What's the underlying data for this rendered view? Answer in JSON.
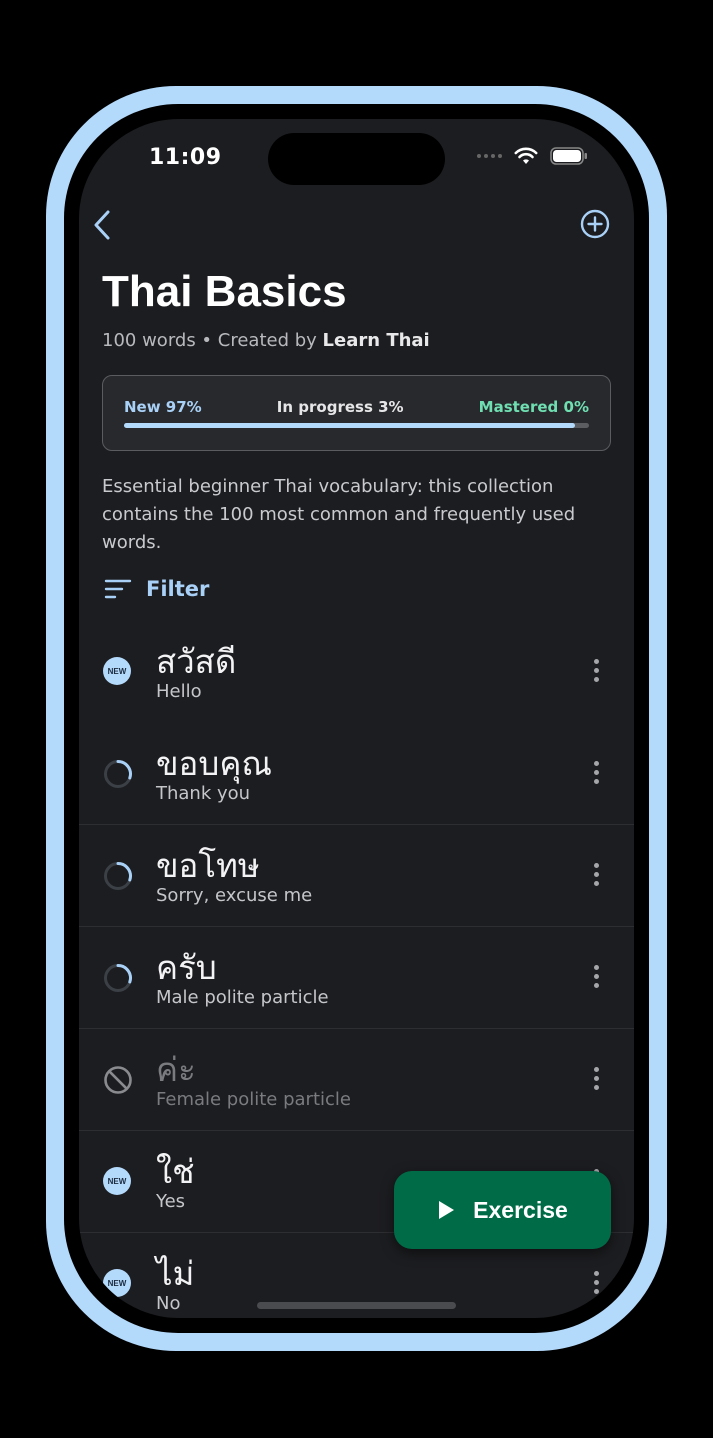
{
  "status_bar": {
    "time": "11:09"
  },
  "header": {
    "title": "Thai Basics",
    "word_count": "100 words",
    "separator": " • ",
    "created_by_prefix": "Created by ",
    "author": "Learn Thai"
  },
  "progress": {
    "new_label": "New 97%",
    "in_progress_label": "In progress 3%",
    "mastered_label": "Mastered 0%",
    "new_fraction": 0.97,
    "colors": {
      "new": "#a9d1f7",
      "mastered": "#6fdfb2",
      "track": "#5b5d61"
    }
  },
  "description": "Essential beginner Thai vocabulary: this collection contains the 100 most common and frequently used words.",
  "filter": {
    "label": "Filter"
  },
  "words": [
    {
      "thai": "สวัสดี",
      "english": "Hello",
      "status": "new"
    },
    {
      "thai": "ขอบคุณ",
      "english": "Thank you",
      "status": "in-progress"
    },
    {
      "thai": "ขอโทษ",
      "english": "Sorry, excuse me",
      "status": "in-progress"
    },
    {
      "thai": "ครับ",
      "english": "Male polite particle",
      "status": "in-progress"
    },
    {
      "thai": "ค่ะ",
      "english": "Female polite particle",
      "status": "excluded"
    },
    {
      "thai": "ใช่",
      "english": "Yes",
      "status": "new"
    },
    {
      "thai": "ไม่",
      "english": "No",
      "status": "new"
    }
  ],
  "badge": {
    "new_text": "NEW"
  },
  "exercise_button": {
    "label": "Exercise"
  },
  "colors": {
    "accent": "#b3d9fb",
    "exercise_bg": "#006b47",
    "background": "#1c1d20"
  }
}
